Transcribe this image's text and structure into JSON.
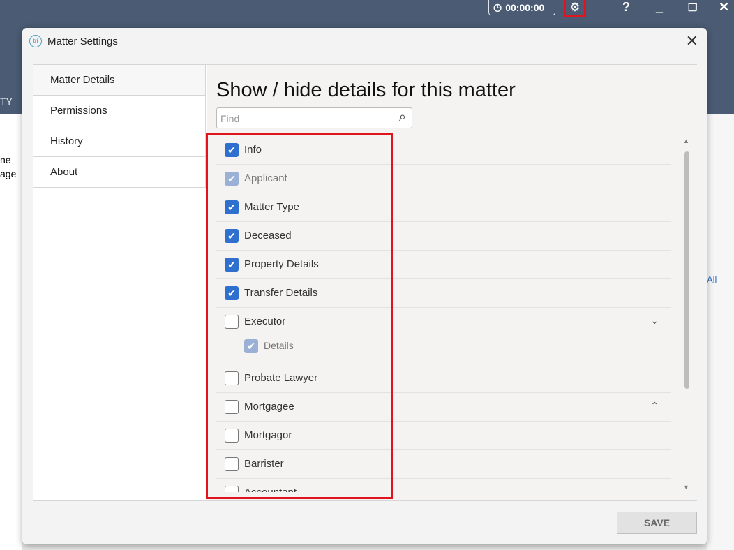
{
  "app": {
    "timer": "00:00:00",
    "bg_fragments": [
      "TY",
      "ne",
      "age",
      "All"
    ]
  },
  "dialog": {
    "title": "Matter Settings",
    "logo": "tri",
    "close": "✕",
    "nav": [
      "Matter Details",
      "Permissions",
      "History",
      "About"
    ],
    "heading": "Show / hide details for this matter",
    "find_placeholder": "Find",
    "items": [
      {
        "label": "Info",
        "state": "checked"
      },
      {
        "label": "Applicant",
        "state": "disabled"
      },
      {
        "label": "Matter Type",
        "state": "checked"
      },
      {
        "label": "Deceased",
        "state": "checked"
      },
      {
        "label": "Property Details",
        "state": "checked"
      },
      {
        "label": "Transfer Details",
        "state": "checked"
      },
      {
        "label": "Executor",
        "state": "unchecked",
        "expanded": true,
        "sub": {
          "label": "Details",
          "state": "disabled"
        }
      },
      {
        "label": "Probate Lawyer",
        "state": "unchecked"
      },
      {
        "label": "Mortgagee",
        "state": "unchecked",
        "collapsed": true
      },
      {
        "label": "Mortgagor",
        "state": "unchecked"
      },
      {
        "label": "Barrister",
        "state": "unchecked"
      },
      {
        "label": "Accountant",
        "state": "unchecked"
      }
    ],
    "save": "SAVE"
  }
}
